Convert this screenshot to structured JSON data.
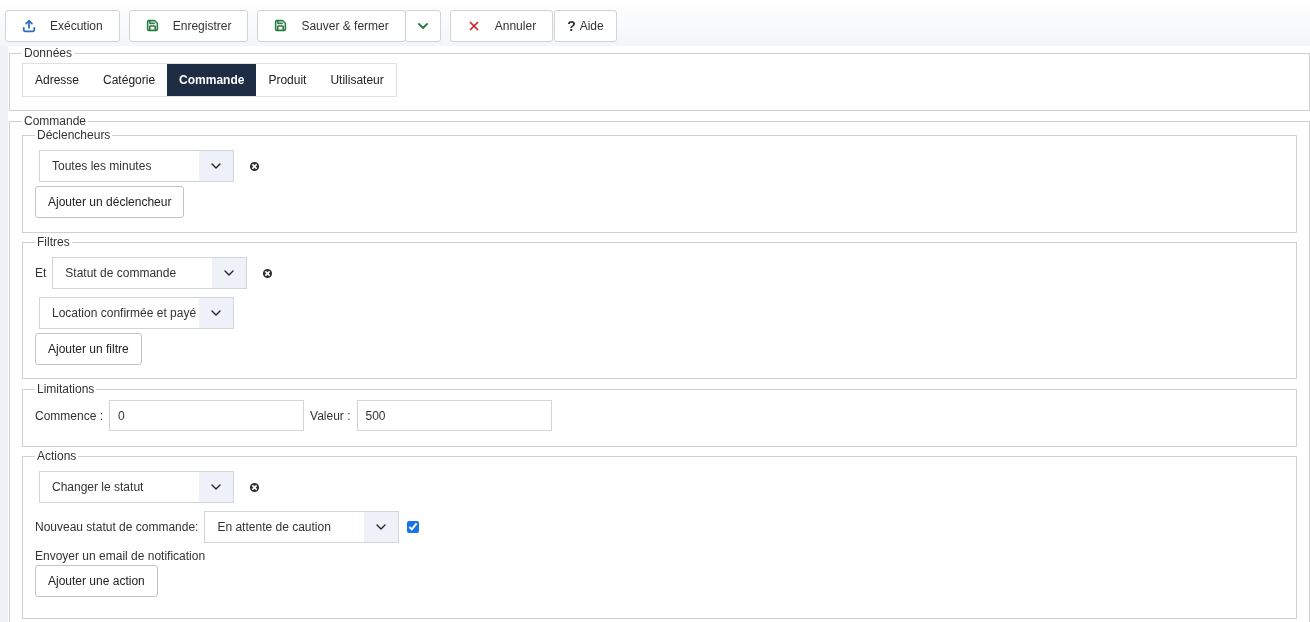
{
  "toolbar": {
    "buttons": [
      {
        "label": "Exécution",
        "kind": "upload"
      },
      {
        "label": "Enregistrer",
        "kind": "save"
      },
      {
        "label": "Sauver & fermer",
        "kind": "save-split"
      },
      {
        "label": "Annuler",
        "kind": "cancel"
      },
      {
        "label": "Aide",
        "kind": "help",
        "glyph": "?"
      }
    ]
  },
  "donnees": {
    "legend": "Données",
    "tabs": [
      {
        "label": "Adresse",
        "selected": false
      },
      {
        "label": "Catégorie",
        "selected": false
      },
      {
        "label": "Commande",
        "selected": true
      },
      {
        "label": "Produit",
        "selected": false
      },
      {
        "label": "Utilisateur",
        "selected": false
      }
    ]
  },
  "commande": {
    "legend": "Commande",
    "declencheurs": {
      "legend": "Déclencheurs",
      "select": "Toutes les minutes",
      "add_button": "Ajouter un déclencheur"
    },
    "filtres": {
      "legend": "Filtres",
      "prefix": "Et",
      "select": "Statut de commande",
      "value_select": "Location confirmée et payé",
      "add_button": "Ajouter un filtre"
    },
    "limitations": {
      "legend": "Limitations",
      "start_label": "Commence :",
      "start_value": "0",
      "value_label": "Valeur :",
      "value_value": "500"
    },
    "actions": {
      "legend": "Actions",
      "select": "Changer le statut",
      "status_label": "Nouveau statut de commande:",
      "status_select": "En attente de caution",
      "notify": {
        "checked": true
      },
      "notify_label": "Envoyer un email de notification",
      "add_button": "Ajouter une action"
    }
  }
}
